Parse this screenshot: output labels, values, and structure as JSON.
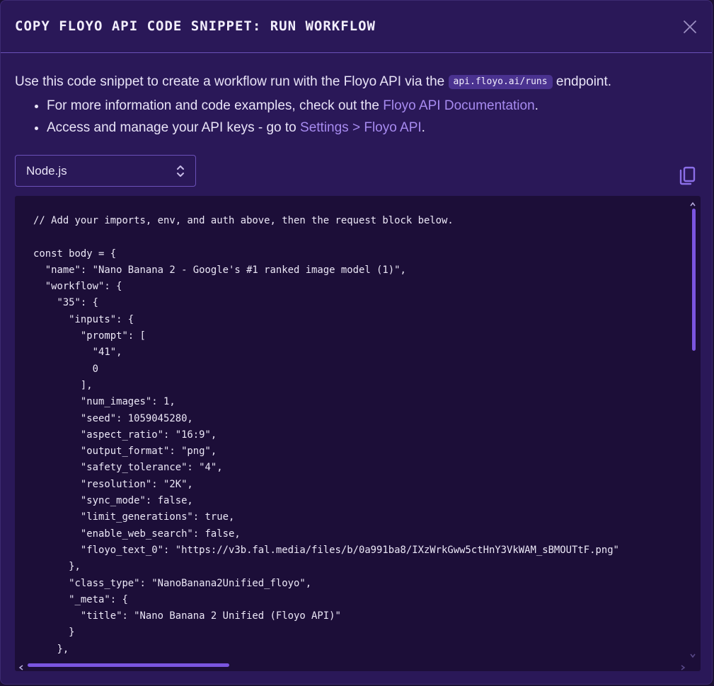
{
  "dialog": {
    "title": "COPY FLOYO API CODE SNIPPET: RUN WORKFLOW",
    "close_icon": "close-icon"
  },
  "intro": {
    "prefix": "Use this code snippet to create a workflow run with the Floyo API via the ",
    "endpoint": "api.floyo.ai/runs",
    "suffix": " endpoint."
  },
  "bullets": [
    {
      "prefix": "For more information and code examples, check out the ",
      "link": "Floyo API Documentation",
      "suffix": "."
    },
    {
      "prefix": "Access and manage your API keys - go to ",
      "link": "Settings > Floyo API",
      "suffix": "."
    }
  ],
  "language_select": {
    "value": "Node.js",
    "icon": "chevron-up-down-icon"
  },
  "copy_icon": "copy-icon",
  "code": "// Add your imports, env, and auth above, then the request block below.\n\nconst body = {\n  \"name\": \"Nano Banana 2 - Google's #1 ranked image model (1)\",\n  \"workflow\": {\n    \"35\": {\n      \"inputs\": {\n        \"prompt\": [\n          \"41\",\n          0\n        ],\n        \"num_images\": 1,\n        \"seed\": 1059045280,\n        \"aspect_ratio\": \"16:9\",\n        \"output_format\": \"png\",\n        \"safety_tolerance\": \"4\",\n        \"resolution\": \"2K\",\n        \"sync_mode\": false,\n        \"limit_generations\": true,\n        \"enable_web_search\": false,\n        \"floyo_text_0\": \"https://v3b.fal.media/files/b/0a991ba8/IXzWrkGww5ctHnY3VkWAM_sBMOUTtF.png\"\n      },\n      \"class_type\": \"NanoBanana2Unified_floyo\",\n      \"_meta\": {\n        \"title\": \"Nano Banana 2 Unified (Floyo API)\"\n      }\n    },",
  "colors": {
    "background": "#2a1858",
    "code_background": "#1c0e38",
    "accent": "#7b55e0",
    "link": "#a78bf0"
  }
}
